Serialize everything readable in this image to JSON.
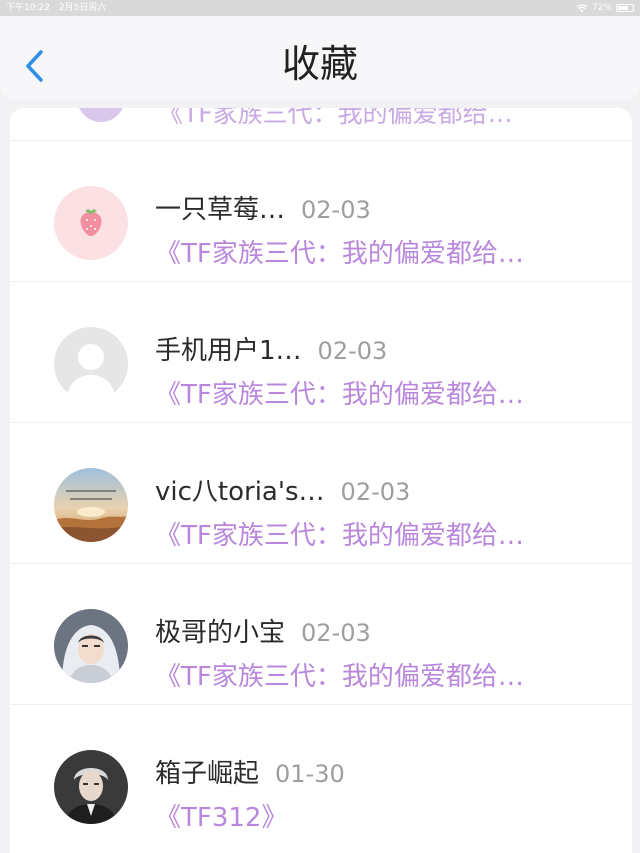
{
  "status_bar": {
    "time": "下午10:22",
    "date": "2月5日周六",
    "battery_level": 0.72,
    "battery_text": "72%"
  },
  "header": {
    "title": "收藏",
    "back_icon": "chevron-left-icon"
  },
  "list": {
    "partial_item_title": "《TF家族三代：我的偏爱都给…",
    "items": [
      {
        "username": "一只草莓…",
        "date": "02-03",
        "title": "《TF家族三代：我的偏爱都给…"
      },
      {
        "username": "手机用户1…",
        "date": "02-03",
        "title": "《TF家族三代：我的偏爱都给…"
      },
      {
        "username": "vic八toria's…",
        "date": "02-03",
        "title": "《TF家族三代：我的偏爱都给…"
      },
      {
        "username": "极哥的小宝",
        "date": "02-03",
        "title": "《TF家族三代：我的偏爱都给…"
      },
      {
        "username": "箱子崛起",
        "date": "01-30",
        "title": "《TF312》"
      }
    ]
  },
  "colors": {
    "accent": "#2f8ee8",
    "title_purple": "#b988dc",
    "date_grey": "#9e9e9e"
  }
}
